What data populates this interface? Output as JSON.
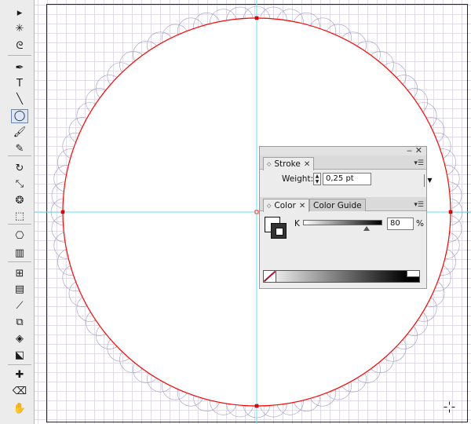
{
  "colors": {
    "selection": "#ff0000",
    "guide": "#5ae6f0",
    "pattern": "#8c8cb4",
    "grid": "#e2dce8",
    "fill_swatch": "#333333"
  },
  "toolbar": {
    "tools": [
      {
        "name": "direct-select-icon",
        "glyph": "▸",
        "active": false
      },
      {
        "name": "magic-wand-icon",
        "glyph": "✳",
        "active": false
      },
      {
        "name": "lasso-icon",
        "glyph": "ᘓ",
        "active": false
      },
      {
        "name": "pen-icon",
        "glyph": "✒",
        "active": false
      },
      {
        "name": "type-icon",
        "glyph": "T",
        "active": false
      },
      {
        "name": "line-segment-icon",
        "glyph": "╲",
        "active": false
      },
      {
        "name": "ellipse-icon",
        "glyph": "◯",
        "active": true
      },
      {
        "name": "paintbrush-icon",
        "glyph": "🖌",
        "active": false
      },
      {
        "name": "pencil-icon",
        "glyph": "✎",
        "active": false
      },
      {
        "name": "rotate-icon",
        "glyph": "↻",
        "active": false
      },
      {
        "name": "scale-icon",
        "glyph": "⤡",
        "active": false
      },
      {
        "name": "warp-icon",
        "glyph": "❂",
        "active": false
      },
      {
        "name": "free-transform-icon",
        "glyph": "⬚",
        "active": false
      },
      {
        "name": "symbol-sprayer-icon",
        "glyph": "⎔",
        "active": false
      },
      {
        "name": "column-graph-icon",
        "glyph": "▥",
        "active": false
      },
      {
        "name": "mesh-icon",
        "glyph": "⊞",
        "active": false
      },
      {
        "name": "gradient-icon",
        "glyph": "▤",
        "active": false
      },
      {
        "name": "eyedropper-icon",
        "glyph": "⟋",
        "active": false
      },
      {
        "name": "blend-icon",
        "glyph": "⧉",
        "active": false
      },
      {
        "name": "live-paint-bucket-icon",
        "glyph": "◈",
        "active": false
      },
      {
        "name": "live-paint-selection-icon",
        "glyph": "⬕",
        "active": false
      },
      {
        "name": "slice-icon",
        "glyph": "✚",
        "active": false
      },
      {
        "name": "eraser-icon",
        "glyph": "⌫",
        "active": false
      },
      {
        "name": "hand-icon",
        "glyph": "✋",
        "active": false
      }
    ]
  },
  "panel": {
    "stroke": {
      "tab_label": "Stroke",
      "weight_label": "Weight:",
      "weight_value": "0,25 pt"
    },
    "color": {
      "tab_label": "Color",
      "guide_tab_label": "Color Guide",
      "channel_label": "K",
      "channel_value": "80",
      "unit": "%",
      "k_level": 0.8
    }
  }
}
